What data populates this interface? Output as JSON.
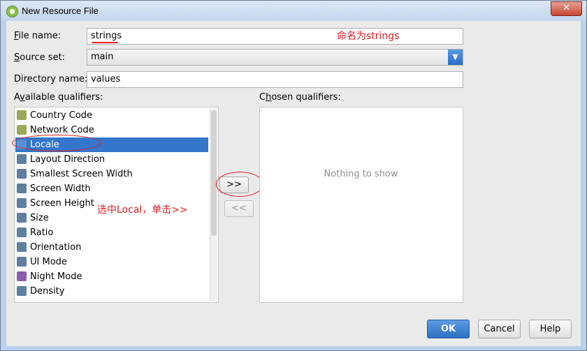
{
  "window": {
    "title": "New Resource File",
    "close_label": "✕"
  },
  "form": {
    "file_name_label_accel": "F",
    "file_name_label_rest": "ile name:",
    "file_name_value": "strings",
    "source_set_label_accel": "S",
    "source_set_label_rest": "ource set:",
    "source_set_value": "main",
    "directory_label": "Directory name:",
    "directory_value": "values"
  },
  "available": {
    "label_pre": "A",
    "label_accel": "v",
    "label_rest": "ailable qualifiers:",
    "items": [
      {
        "label": "Country Code",
        "icon": "country-code-icon",
        "color": "#9aa85a"
      },
      {
        "label": "Network Code",
        "icon": "network-code-icon",
        "color": "#9aa85a"
      },
      {
        "label": "Locale",
        "icon": "locale-globe-icon",
        "color": "#5c8fd6"
      },
      {
        "label": "Layout Direction",
        "icon": "layout-direction-icon",
        "color": "#5f7f9f"
      },
      {
        "label": "Smallest Screen Width",
        "icon": "smallest-width-icon",
        "color": "#5f7f9f"
      },
      {
        "label": "Screen Width",
        "icon": "screen-width-icon",
        "color": "#5f7f9f"
      },
      {
        "label": "Screen Height",
        "icon": "screen-height-icon",
        "color": "#5f7f9f"
      },
      {
        "label": "Size",
        "icon": "size-icon",
        "color": "#5f7f9f"
      },
      {
        "label": "Ratio",
        "icon": "ratio-icon",
        "color": "#5f7f9f"
      },
      {
        "label": "Orientation",
        "icon": "orientation-icon",
        "color": "#5f7f9f"
      },
      {
        "label": "UI Mode",
        "icon": "ui-mode-icon",
        "color": "#5f7f9f"
      },
      {
        "label": "Night Mode",
        "icon": "night-mode-icon",
        "color": "#8a5fa8"
      },
      {
        "label": "Density",
        "icon": "density-icon",
        "color": "#5f7f9f"
      }
    ],
    "selected_index": 2
  },
  "chosen": {
    "label_pre": "C",
    "label_accel": "h",
    "label_rest": "osen qualifiers:",
    "empty_text": "Nothing to show"
  },
  "move": {
    "add_label": ">>",
    "remove_label": "<<"
  },
  "annotations": {
    "name_note": "命名为strings",
    "select_note": "选中Local，单击>>",
    "color": "#e02020"
  },
  "buttons": {
    "ok": "OK",
    "cancel": "Cancel",
    "help": "Help"
  },
  "colors": {
    "selection": "#3476cb",
    "accent": "#2d6fc4"
  }
}
